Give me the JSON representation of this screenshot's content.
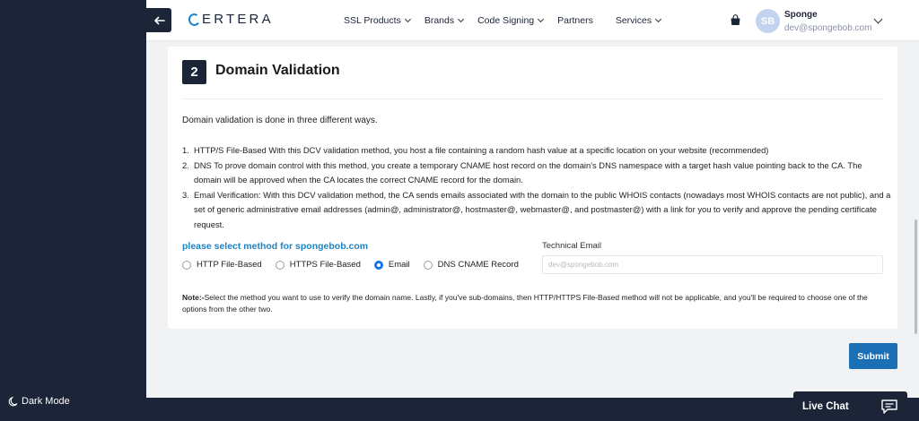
{
  "header": {
    "logo_initial": "C",
    "logo_rest": "ERTERA",
    "nav": [
      {
        "label": "SSL Products",
        "has_dropdown": true
      },
      {
        "label": "Brands",
        "has_dropdown": true
      },
      {
        "label": "Code Signing",
        "has_dropdown": true
      },
      {
        "label": "Partners",
        "has_dropdown": false
      },
      {
        "label": "Services",
        "has_dropdown": true
      }
    ],
    "user": {
      "initials": "SB",
      "name": "Sponge",
      "email": "dev@spongebob.com"
    }
  },
  "sidebar": {
    "dark_mode_label": "Dark Mode"
  },
  "card": {
    "step_number": "2",
    "title": "Domain Validation",
    "intro": "Domain validation is done in three different ways.",
    "methods": [
      {
        "num": "1.",
        "text": "HTTP/S File-Based With this DCV validation method, you host a file containing a random hash value at a specific location on your website (recommended)"
      },
      {
        "num": "2.",
        "text": "DNS To prove domain control with this method, you create a temporary CNAME host record on the domain's DNS namespace with a target hash value pointing back to the CA. The domain will be approved when the CA locates the correct CNAME record for the domain."
      },
      {
        "num": "3.",
        "text": "Email Verification: With this DCV validation method, the CA sends emails associated with the domain to the public WHOIS contacts (nowadays most WHOIS contacts are not public), and a set of generic administrative email addresses (admin@, administrator@, hostmaster@, webmaster@, and postmaster@) with a link for you to verify and approve the pending certificate request."
      }
    ],
    "select_label": "please select method for spongebob.com",
    "options": [
      {
        "label": "HTTP File-Based",
        "checked": false
      },
      {
        "label": "HTTPS File-Based",
        "checked": false
      },
      {
        "label": "Email",
        "checked": true
      },
      {
        "label": "DNS CNAME Record",
        "checked": false
      }
    ],
    "technical_email_label": "Technical Email",
    "technical_email_placeholder": "dev@spongebob.com",
    "note_label": "Note:-",
    "note_text": "Select the method you want to use to verify the domain name. Lastly, if you've sub-domains, then HTTP/HTTPS File-Based method will not be applicable, and you'll be required to choose one of the options from the other two."
  },
  "actions": {
    "submit_label": "Submit"
  },
  "chat": {
    "label": "Live Chat"
  },
  "colors": {
    "navy": "#1c2437",
    "accent_blue": "#1a84c7",
    "submit_blue": "#1a6fb5",
    "radio_blue": "#1a73e8"
  }
}
